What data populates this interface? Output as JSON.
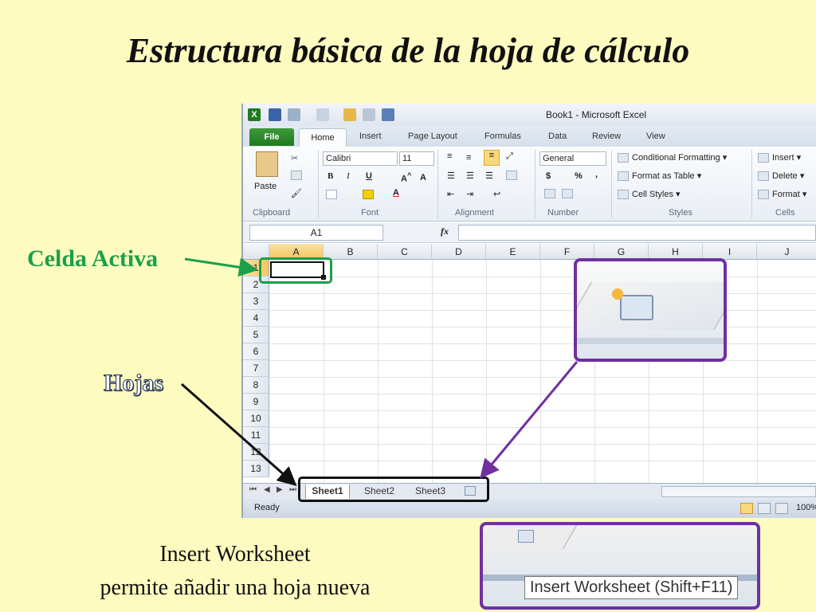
{
  "slide": {
    "title": "Estructura básica de la hoja de cálculo",
    "label_active_cell": "Celda Activa",
    "label_sheets": "Hojas",
    "note_line1": "Insert Worksheet",
    "note_line2": "permite añadir una hoja nueva",
    "tooltip": "Insert Worksheet (Shift+F11)"
  },
  "colors": {
    "green": "#1aa04a",
    "purple": "#7030a0",
    "background": "#fdfbc0"
  },
  "excel": {
    "window_title": "Book1  -  Microsoft Excel",
    "tabs": {
      "file": "File",
      "home": "Home",
      "insert": "Insert",
      "page_layout": "Page Layout",
      "formulas": "Formulas",
      "data": "Data",
      "review": "Review",
      "view": "View"
    },
    "ribbon": {
      "paste": "Paste",
      "font_name": "Calibri",
      "font_size": "11",
      "number_format": "General",
      "currency": "$",
      "percent": "%",
      "comma": ",",
      "cond_format": "Conditional Formatting",
      "format_table": "Format as Table",
      "cell_styles": "Cell Styles",
      "insert": "Insert",
      "delete": "Delete",
      "format": "Format",
      "groups": {
        "clipboard": "Clipboard",
        "font": "Font",
        "alignment": "Alignment",
        "number": "Number",
        "styles": "Styles",
        "cells": "Cells"
      }
    },
    "name_box": "A1",
    "fx": "fx",
    "columns": [
      "A",
      "B",
      "C",
      "D",
      "E",
      "F",
      "G",
      "H",
      "I",
      "J"
    ],
    "rows": [
      "1",
      "2",
      "3",
      "4",
      "5",
      "6",
      "7",
      "8",
      "9",
      "10",
      "11",
      "12",
      "13"
    ],
    "sheets": {
      "s1": "Sheet1",
      "s2": "Sheet2",
      "s3": "Sheet3"
    },
    "status": "Ready",
    "zoom": "100%"
  }
}
